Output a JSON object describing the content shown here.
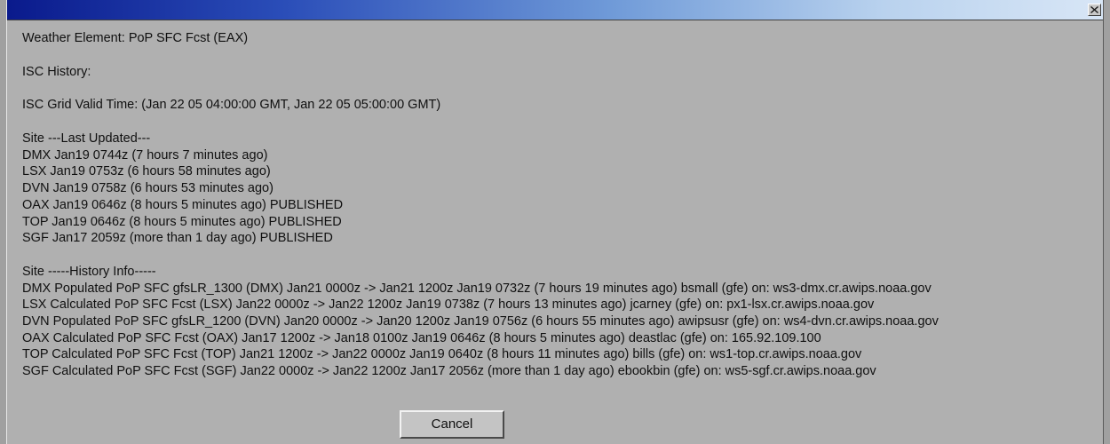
{
  "window": {
    "title": "",
    "close_icon": "close-x-icon"
  },
  "header": {
    "weather_element": "Weather Element: PoP SFC Fcst (EAX)",
    "isc_history": "ISC History:",
    "isc_valid_time": "ISC Grid Valid Time: (Jan 22 05 04:00:00 GMT, Jan 22 05 05:00:00 GMT)"
  },
  "last_updated": {
    "heading": "Site  ---Last Updated---",
    "rows": [
      "DMX Jan19 0744z (7 hours 7 minutes ago)",
      "LSX Jan19 0753z (6 hours 58 minutes ago)",
      "DVN Jan19 0758z (6 hours 53 minutes ago)",
      "OAX Jan19 0646z (8 hours 5 minutes ago)  PUBLISHED",
      "TOP Jan19 0646z (8 hours 5 minutes ago)  PUBLISHED",
      "SGF Jan17 2059z (more than 1 day ago)  PUBLISHED"
    ]
  },
  "history_info": {
    "heading": "Site  -----History Info-----",
    "rows": [
      "DMX Populated PoP SFC gfsLR_1300 (DMX) Jan21 0000z -> Jan21 1200z Jan19 0732z (7 hours 19 minutes ago) bsmall (gfe)  on: ws3-dmx.cr.awips.noaa.gov",
      "LSX Calculated PoP SFC Fcst (LSX) Jan22 0000z -> Jan22 1200z Jan19 0738z (7 hours 13 minutes ago) jcarney (gfe)  on: px1-lsx.cr.awips.noaa.gov",
      "DVN Populated PoP SFC gfsLR_1200 (DVN) Jan20 0000z -> Jan20 1200z Jan19 0756z (6 hours 55 minutes ago) awipsusr (gfe)  on: ws4-dvn.cr.awips.noaa.gov",
      "OAX Calculated PoP SFC Fcst (OAX) Jan17 1200z -> Jan18 0100z Jan19 0646z (8 hours 5 minutes ago) deastlac (gfe)  on: 165.92.109.100",
      "TOP Calculated PoP SFC Fcst (TOP) Jan21 1200z -> Jan22 0000z Jan19 0640z (8 hours 11 minutes ago) bills (gfe)  on: ws1-top.cr.awips.noaa.gov",
      "SGF Calculated PoP SFC Fcst (SGF) Jan22 0000z -> Jan22 1200z Jan17 2056z (more than 1 day ago) ebookbin (gfe)  on: ws5-sgf.cr.awips.noaa.gov"
    ]
  },
  "buttons": {
    "cancel": "Cancel"
  },
  "colors": {
    "title_gradient_start": "#0a1a8c",
    "title_gradient_end": "#d8e6f6",
    "dialog_bg": "#b0b0b0"
  }
}
